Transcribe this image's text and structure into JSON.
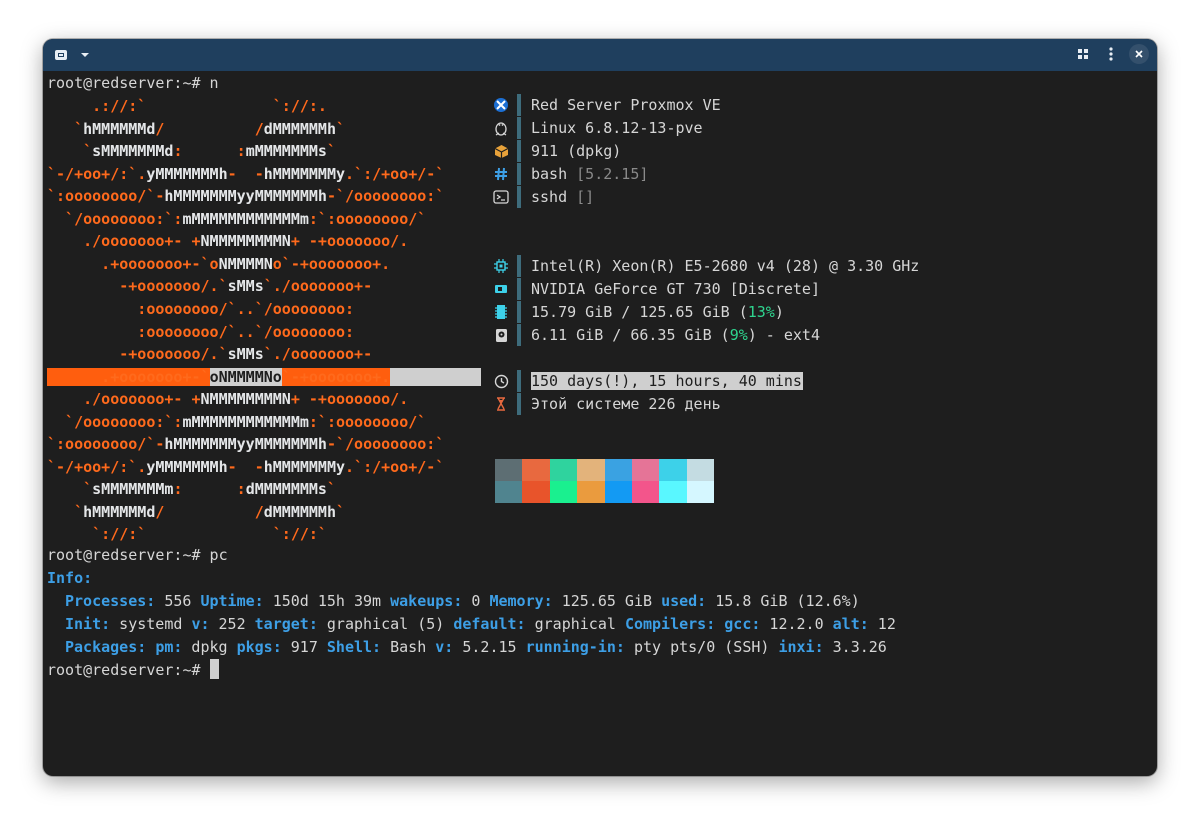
{
  "window": {
    "title_icon": "terminal-icon",
    "menu_icon": "chevron-down-icon",
    "grid_icon": "grid-icon",
    "kebab_icon": "more-vertical-icon",
    "close_icon": "close-icon"
  },
  "commands": {
    "first": "root@redserver:~# n",
    "second": "root@redserver:~# pc",
    "prompt": "root@redserver:~# "
  },
  "logo_lines": [
    "     .://:`              `://:.",
    "   `hMMMMMMd/          /dMMMMMMh`",
    "    `sMMMMMMMd:      :mMMMMMMMs`",
    "`-/+oo+/:`.yMMMMMMMh-  -hMMMMMMMy.`:/+oo+/-`",
    "`:oooooooo/`-hMMMMMMMyyMMMMMMMh-`/oooooooo:`",
    "  `/oooooooo:`:mMMMMMMMMMMMMm:`:oooooooo/`",
    "    ./ooooooo+- +NMMMMMMMMN+ -+ooooooo/.",
    "      .+ooooooo+-`oNMMMMNo`-+ooooooo+.",
    "        -+ooooooo/.`sMMs`./ooooooo+-",
    "          :oooooooo/`..`/oooooooo:",
    "          :oooooooo/`..`/oooooooo:",
    "        -+ooooooo/.`sMMs`./ooooooo+-",
    "      .+ooooooo+-`oNMMMMNo`-+ooooooo+.",
    "    ./ooooooo+- +NMMMMMMMMN+ -+ooooooo/.",
    "  `/oooooooo:`:mMMMMMMMMMMMMm:`:oooooooo/`",
    "`:oooooooo/`-hMMMMMMMyyMMMMMMMh-`/oooooooo:`",
    "`-/+oo+/:`.yMMMMMMMh-  -hMMMMMMMy.`:/+oo+/-`",
    "    `sMMMMMMMm:      :dMMMMMMMs`",
    "   `hMMMMMMd/          /dMMMMMMh`",
    "     `://:`              `://:`"
  ],
  "sysinfo": [
    {
      "icon": "proxmox-logo-icon",
      "text": "Red Server Proxmox VE",
      "extra": ""
    },
    {
      "icon": "linux-penguin-icon",
      "text": "Linux 6.8.12-13-pve",
      "extra": ""
    },
    {
      "icon": "package-icon",
      "text": "911 (dpkg)",
      "extra": ""
    },
    {
      "icon": "hash-icon",
      "text": "bash ",
      "extra": "[5.2.15]"
    },
    {
      "icon": "terminal-prompt-icon",
      "text": "sshd ",
      "extra": "[]"
    }
  ],
  "hardware": {
    "cpu_icon": "cpu-icon",
    "cpu": "Intel(R) Xeon(R) E5-2680 v4 (28) @ 3.30 GHz",
    "gpu_icon": "gpu-icon",
    "gpu": "NVIDIA GeForce GT 730 [Discrete]",
    "mem_icon": "memory-icon",
    "mem_prefix": "15.79 GiB / 125.65 GiB (",
    "mem_percent": "13%",
    "mem_suffix": ")",
    "disk_icon": "disk-icon",
    "disk_prefix": "6.11 GiB / 66.35 GiB (",
    "disk_percent": "9%",
    "disk_suffix": ") - ext4",
    "uptime_icon": "clock-icon",
    "uptime": "150 days(!), 15 hours, 40 mins",
    "age_icon": "hourglass-icon",
    "age": "Этой системе 226 день"
  },
  "palette": {
    "top": [
      "#5d6e73",
      "#e8693f",
      "#2fd39e",
      "#e3b37b",
      "#3aa2e2",
      "#e57497",
      "#3dd1e9",
      "#c4dce2"
    ],
    "bottom": [
      "#50848f",
      "#e8542b",
      "#1af08f",
      "#ea9b3e",
      "#139af3",
      "#f3558b",
      "#59f7ff",
      "#d5f7ff"
    ]
  },
  "pc": {
    "heading": "Info:",
    "line1": [
      {
        "k": "Processes:",
        "v": " 556 "
      },
      {
        "k": "Uptime:",
        "v": " 150d 15h 39m "
      },
      {
        "k": "wakeups:",
        "v": " 0 "
      },
      {
        "k": "Memory:",
        "v": " 125.65 GiB "
      },
      {
        "k": "used:",
        "v": " 15.8 GiB (12.6%)"
      }
    ],
    "line2": [
      {
        "k": "Init:",
        "v": " systemd "
      },
      {
        "k": "v:",
        "v": " 252 "
      },
      {
        "k": "target:",
        "v": " graphical (5) "
      },
      {
        "k": "default:",
        "v": " graphical "
      },
      {
        "k": "Compilers:",
        "v": " "
      },
      {
        "k": "gcc:",
        "v": " 12.2.0 "
      },
      {
        "k": "alt:",
        "v": " 12"
      }
    ],
    "line3": [
      {
        "k": "Packages:",
        "v": " "
      },
      {
        "k": "pm:",
        "v": " dpkg "
      },
      {
        "k": "pkgs:",
        "v": " 917 "
      },
      {
        "k": "Shell:",
        "v": " Bash "
      },
      {
        "k": "v:",
        "v": " 5.2.15 "
      },
      {
        "k": "running-in:",
        "v": " pty pts/0 (SSH) "
      },
      {
        "k": "inxi:",
        "v": " 3.3.26"
      }
    ]
  }
}
